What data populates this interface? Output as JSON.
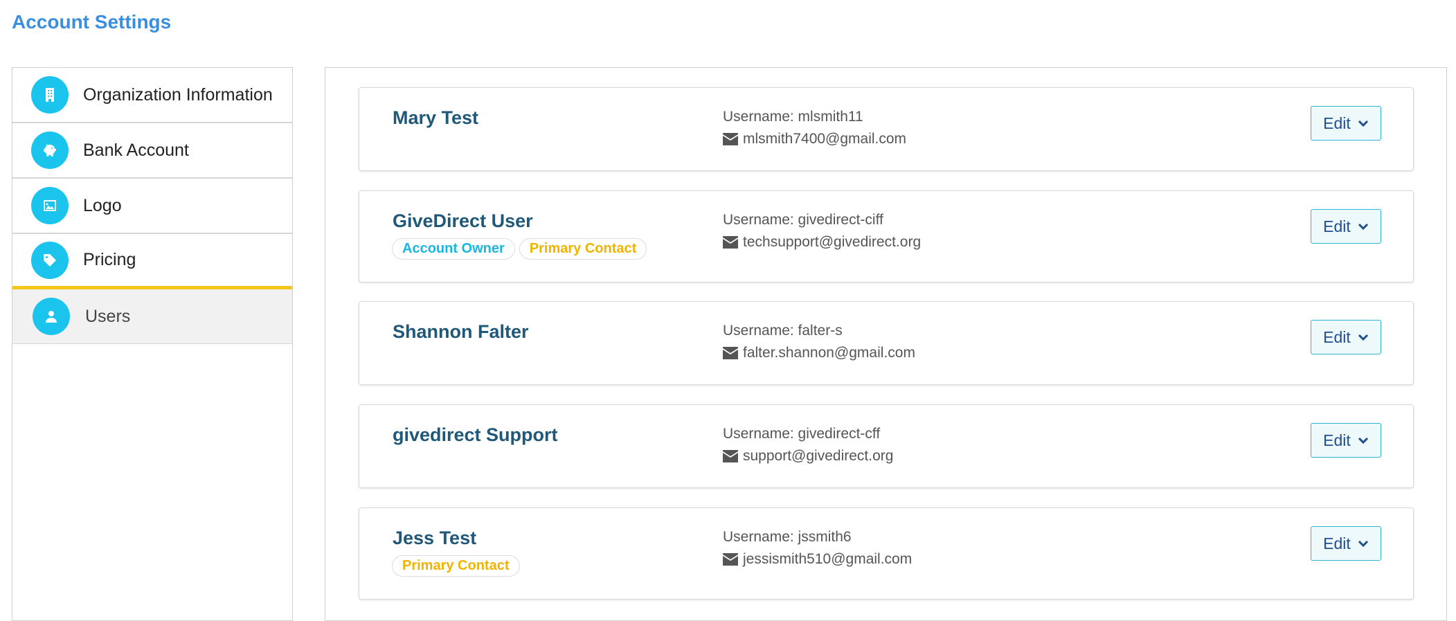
{
  "page": {
    "title": "Account Settings"
  },
  "sidebar": {
    "items": [
      {
        "label": "Organization Information",
        "icon": "building-icon"
      },
      {
        "label": "Bank Account",
        "icon": "piggy-bank-icon"
      },
      {
        "label": "Logo",
        "icon": "image-icon"
      },
      {
        "label": "Pricing",
        "icon": "tag-icon"
      },
      {
        "label": "Users",
        "icon": "user-icon",
        "active": true
      }
    ]
  },
  "users": [
    {
      "name": "Mary Test",
      "username": "Username: mlsmith11",
      "email": "mlsmith7400@gmail.com",
      "badges": []
    },
    {
      "name": "GiveDirect User",
      "username": "Username: givedirect-ciff",
      "email": "techsupport@givedirect.org",
      "badges": [
        "Account Owner",
        "Primary Contact"
      ]
    },
    {
      "name": "Shannon Falter",
      "username": "Username: falter-s",
      "email": "falter.shannon@gmail.com",
      "badges": []
    },
    {
      "name": "givedirect Support",
      "username": "Username: givedirect-cff",
      "email": "support@givedirect.org",
      "badges": []
    },
    {
      "name": "Jess Test",
      "username": "Username: jssmith6",
      "email": "jessismith510@gmail.com",
      "badges": [
        "Primary Contact"
      ]
    }
  ],
  "edit_label": "Edit",
  "colors": {
    "title": "#3a8ee0",
    "icon_bg": "#1ac4ec",
    "active_indicator": "#f5c518",
    "name": "#1f5878",
    "owner_badge": "#1ab6e2",
    "contact_badge": "#f0b400"
  }
}
